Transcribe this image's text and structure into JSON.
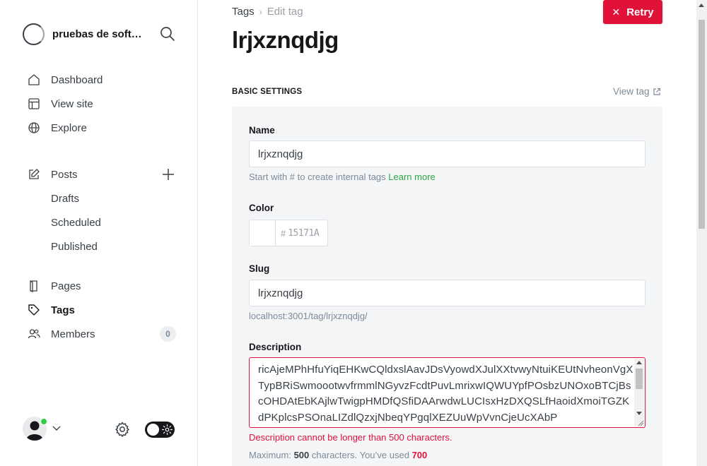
{
  "sidebar": {
    "site_name": "pruebas de soft…",
    "main_nav": [
      {
        "label": "Dashboard",
        "icon": "house-icon"
      },
      {
        "label": "View site",
        "icon": "layout-icon"
      },
      {
        "label": "Explore",
        "icon": "globe-icon"
      }
    ],
    "posts": {
      "label": "Posts",
      "icon": "edit-icon",
      "children": [
        "Drafts",
        "Scheduled",
        "Published"
      ]
    },
    "content_nav": [
      {
        "label": "Pages",
        "icon": "page-icon"
      },
      {
        "label": "Tags",
        "icon": "tag-icon",
        "active": true
      },
      {
        "label": "Members",
        "icon": "members-icon",
        "count": "0"
      }
    ]
  },
  "header": {
    "breadcrumb_parent": "Tags",
    "breadcrumb_current": "Edit tag",
    "title": "lrjxznqdjg",
    "retry_label": "Retry"
  },
  "section": {
    "heading": "BASIC SETTINGS",
    "view_tag_label": "View tag"
  },
  "form": {
    "name_label": "Name",
    "name_value": "lrjxznqdjg",
    "name_hint": "Start with # to create internal tags",
    "name_hint_link": "Learn more",
    "color_label": "Color",
    "color_hash": "#",
    "color_value": "15171A",
    "slug_label": "Slug",
    "slug_value": "lrjxznqdjg",
    "slug_url": "localhost:3001/tag/lrjxznqdjg/",
    "description_label": "Description",
    "description_value": "ricAjeMPhHfuYiqEHKwCQldxslAavJDsVyowdXJulXXtvwyNtuiKEUtNvheonVgXTypBRiSwmoootwvfrmmlNGyvzFcdtPuvLmrixwIQWUYpfPOsbzUNOxoBTCjBscOHDAtEbKAjlwTwigpHMDfQSfiDAArwdwLUCIsxHzDXQSLfHaoidXmoiTGZKdPKplcsPSOnaLIZdlQzxjNbeqYPgqlXEZUuWpVvnCjeUcXAbP",
    "error": "Description cannot be longer than 500 characters.",
    "counter_prefix": "Maximum:",
    "counter_max": "500",
    "counter_mid": "characters. You’ve used",
    "counter_used": "700"
  },
  "colors": {
    "accent_red": "#e0123a",
    "link_green": "#30cf43",
    "online_green": "#30cf43"
  }
}
